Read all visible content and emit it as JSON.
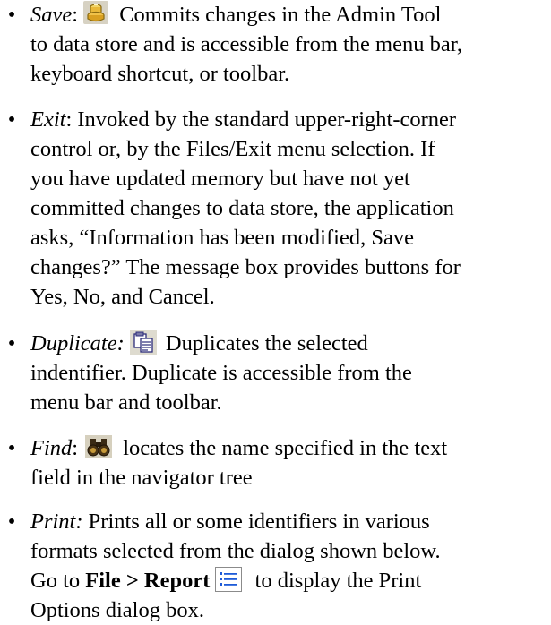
{
  "bullet": "•",
  "items": [
    {
      "term": "Save",
      "lines": [
        [
          ":",
          " Commits changes in the Admin Tool"
        ],
        [
          "to data store and is accessible from the menu bar,"
        ],
        [
          "keyboard shortcut, or toolbar."
        ]
      ],
      "icon": "save-icon"
    },
    {
      "term": "Exit",
      "lines": [
        [
          ": Invoked by the standard upper-right-corner"
        ],
        [
          "control or, by the Files/Exit menu selection. If"
        ],
        [
          "you have updated memory but have not yet"
        ],
        [
          "committed changes to data store, the application"
        ],
        [
          "asks, “Information has been modified, Save"
        ],
        [
          "changes?” The message box provides buttons for"
        ],
        [
          "Yes, No, and Cancel."
        ]
      ]
    },
    {
      "term": "Duplicate:",
      "lines": [
        [
          " Duplicates the selected"
        ],
        [
          "indentifier. Duplicate is accessible from the"
        ],
        [
          "menu bar and toolbar."
        ]
      ],
      "icon": "duplicate-icon"
    },
    {
      "term": "Find",
      "lines": [
        [
          ":",
          " locates the name specified in the text"
        ],
        [
          "field in the navigator tree"
        ]
      ],
      "icon": "binoculars-icon"
    },
    {
      "term": "Print:",
      "lines": [
        [
          " Prints all or some identifiers in various"
        ],
        [
          "formats selected from the dialog shown below."
        ],
        [
          "Go to ",
          "File > Report",
          " to display the Print"
        ],
        [
          "Options dialog box."
        ]
      ],
      "icon": "report-icon"
    }
  ]
}
